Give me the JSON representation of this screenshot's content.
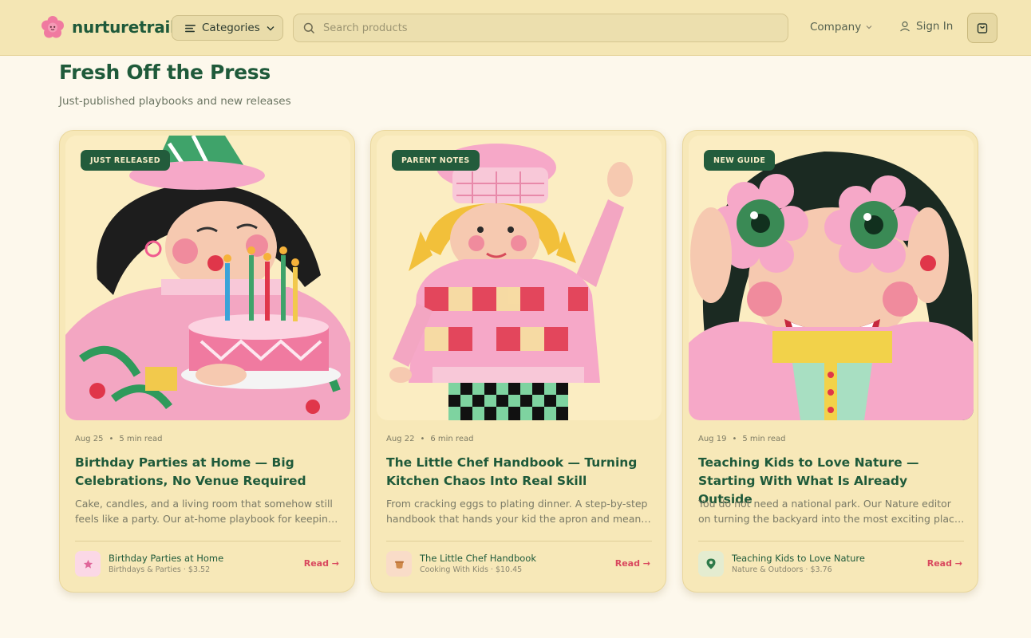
{
  "header": {
    "brand": "nurturetrail",
    "categories_label": "Categories",
    "search_placeholder": "Search products",
    "company_label": "Company",
    "signin_label": "Sign In",
    "colors": {
      "bar": "#f4e6b4",
      "brand_green": "#1f5a3a",
      "accent_pink": "#f07aa0"
    }
  },
  "section": {
    "title": "Fresh Off the Press",
    "subtitle": "Just-published playbooks and new releases"
  },
  "cards": [
    {
      "badge": "JUST RELEASED",
      "date": "Aug 25",
      "read_time": "5 min read",
      "title": "Birthday Parties at Home — Big Celebrations, No Venue Required",
      "description": "Cake, candles, and a living room that somehow still feels like a party. Our at-home playbook for keeping it simple and special.",
      "product_name": "Birthday Parties at Home",
      "product_meta": "Birthdays & Parties · $3.52",
      "product_icon": "star-icon",
      "read_label": "Read →"
    },
    {
      "badge": "PARENT NOTES",
      "date": "Aug 22",
      "read_time": "6 min read",
      "title": "The Little Chef Handbook — Turning Kitchen Chaos Into Real Skill",
      "description": "From cracking eggs to plating dinner. A step-by-step handbook that hands your kid the apron and means it.",
      "product_name": "The Little Chef Handbook",
      "product_meta": "Cooking With Kids · $10.45",
      "product_icon": "pot-icon",
      "read_label": "Read →"
    },
    {
      "badge": "NEW GUIDE",
      "date": "Aug 19",
      "read_time": "5 min read",
      "title": "Teaching Kids to Love Nature — Starting With What Is Already Outside",
      "description": "You do not need a national park. Our Nature editor on turning the backyard into the most exciting place in the neighborhood.",
      "product_name": "Teaching Kids to Love Nature",
      "product_meta": "Nature & Outdoors · $3.76",
      "product_icon": "map-pin-icon",
      "read_label": "Read →"
    }
  ]
}
